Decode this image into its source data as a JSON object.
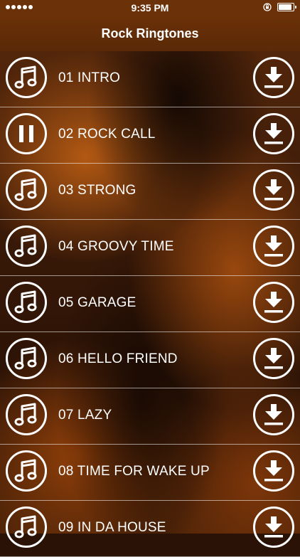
{
  "status_bar": {
    "time": "9:35 PM",
    "signal_dots": 5
  },
  "nav": {
    "title": "Rock Ringtones"
  },
  "colors": {
    "bar_brown": "#6b3108",
    "text": "#ffffff"
  },
  "ringtones": [
    {
      "label": "01 INTRO",
      "state_icon": "music-note-icon"
    },
    {
      "label": "02 ROCK CALL",
      "state_icon": "pause-icon"
    },
    {
      "label": "03 STRONG",
      "state_icon": "music-note-icon"
    },
    {
      "label": "04 GROOVY TIME",
      "state_icon": "music-note-icon"
    },
    {
      "label": "05 GARAGE",
      "state_icon": "music-note-icon"
    },
    {
      "label": "06 HELLO FRIEND",
      "state_icon": "music-note-icon"
    },
    {
      "label": "07 LAZY",
      "state_icon": "music-note-icon"
    },
    {
      "label": "08 TIME FOR WAKE UP",
      "state_icon": "music-note-icon"
    },
    {
      "label": "09 IN DA HOUSE",
      "state_icon": "music-note-icon"
    }
  ],
  "download_icon": "download-icon"
}
